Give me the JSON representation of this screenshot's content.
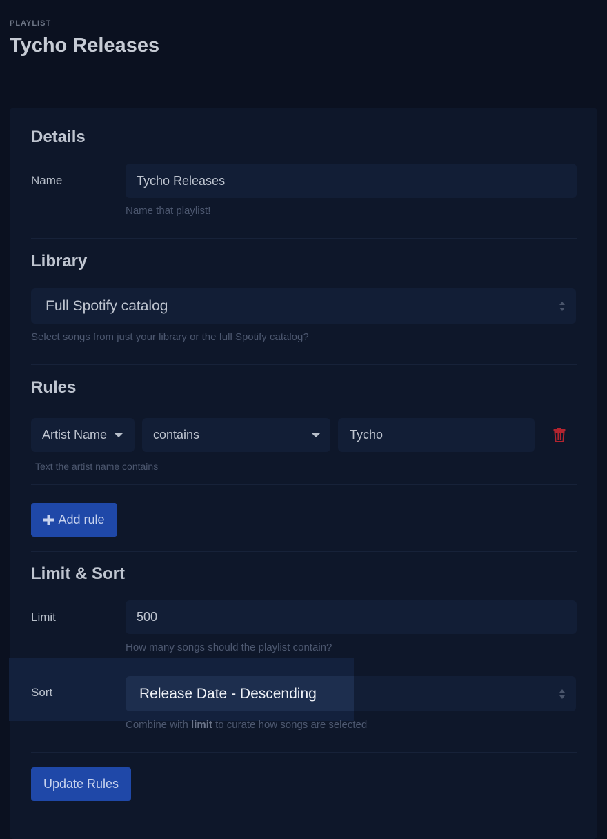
{
  "header": {
    "overline": "PLAYLIST",
    "title": "Tycho Releases"
  },
  "details": {
    "title": "Details",
    "name_label": "Name",
    "name_value": "Tycho Releases",
    "name_help": "Name that playlist!"
  },
  "library": {
    "title": "Library",
    "selected": "Full Spotify catalog",
    "help": "Select songs from just your library or the full Spotify catalog?"
  },
  "rules": {
    "title": "Rules",
    "items": [
      {
        "field": "Artist Name",
        "operator": "contains",
        "value": "Tycho",
        "help": "Text the artist name contains"
      }
    ],
    "add_label": "Add rule"
  },
  "limit_sort": {
    "title": "Limit & Sort",
    "limit_label": "Limit",
    "limit_value": "500",
    "limit_help": "How many songs should the playlist contain?",
    "sort_label": "Sort",
    "sort_value": "Release Date - Descending",
    "sort_help_pre": "Combine with",
    "sort_help_bold": "limit",
    "sort_help_post": "to curate how songs are selected"
  },
  "actions": {
    "update_label": "Update Rules"
  },
  "colors": {
    "background": "#0b1120",
    "card": "#0e172a",
    "primary": "#1f48a8",
    "danger": "#b3242f"
  },
  "icons": {
    "add": "plus-icon",
    "delete": "trash-icon",
    "select": "chevron-down-icon"
  }
}
